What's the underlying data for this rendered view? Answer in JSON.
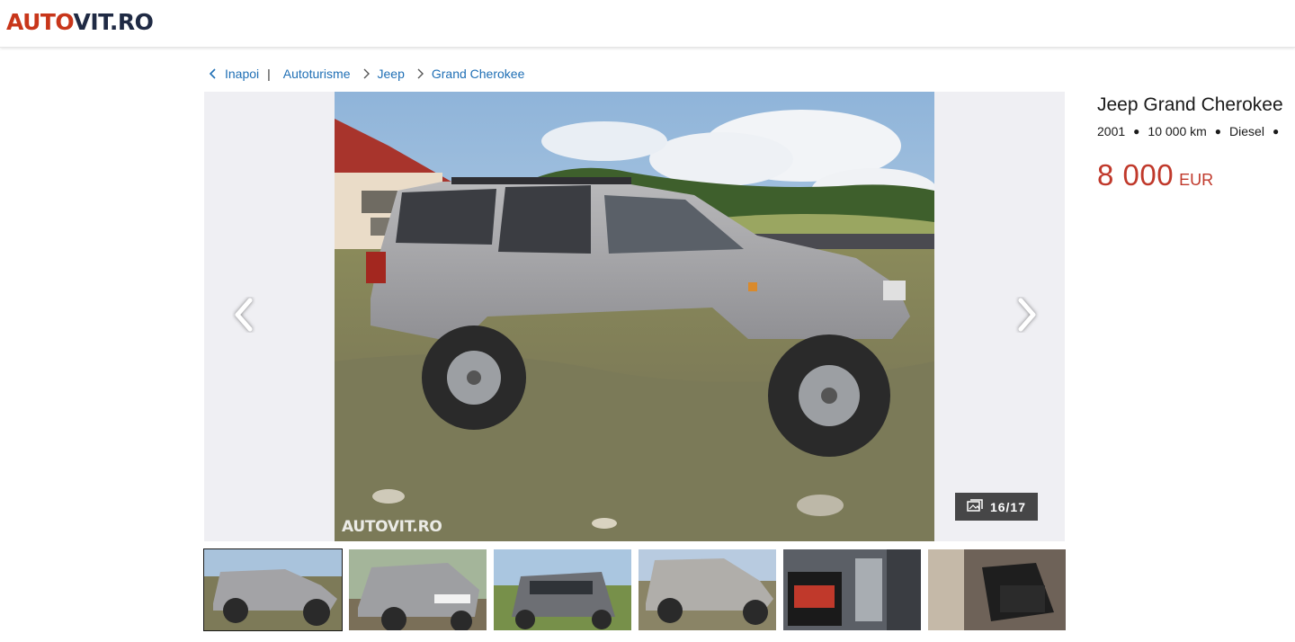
{
  "header": {
    "logo_part1": "AUTO",
    "logo_part2": "VIT.RO"
  },
  "breadcrumb": {
    "back": "Inapoi",
    "separator": "|",
    "items": [
      "Autoturisme",
      "Jeep",
      "Grand Cherokee"
    ]
  },
  "gallery": {
    "counter": "16/17",
    "watermark": "AUTOVIT.RO",
    "prev_icon": "chevron-left-icon",
    "next_icon": "chevron-right-icon",
    "counter_icon": "photos-icon",
    "thumbnails": [
      {
        "alt": "Side view of silver Jeep",
        "active": true
      },
      {
        "alt": "Front view with plate",
        "active": false
      },
      {
        "alt": "Front view green field",
        "active": false
      },
      {
        "alt": "Side view parking",
        "active": false
      },
      {
        "alt": "Engine parts box",
        "active": false
      },
      {
        "alt": "Interior seats",
        "active": false
      }
    ]
  },
  "listing": {
    "title": "Jeep Grand Cherokee",
    "year": "2001",
    "mileage": "10 000 km",
    "fuel": "Diesel",
    "price": "8 000",
    "currency": "EUR"
  },
  "colors": {
    "brand_red": "#c8361a",
    "brand_navy": "#1f2a44",
    "link": "#1f6fb5",
    "price": "#c0392b"
  }
}
